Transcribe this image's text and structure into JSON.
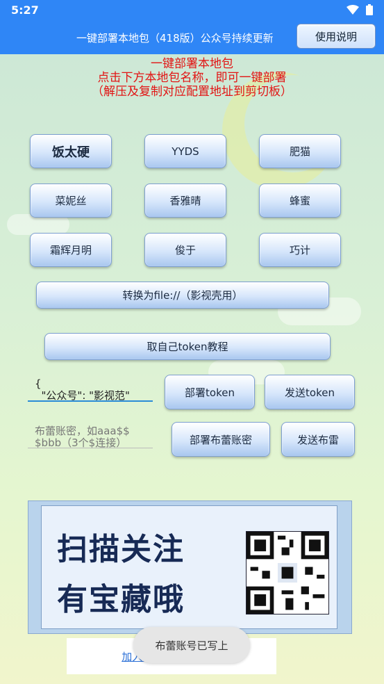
{
  "status_bar": {
    "time": "5:27"
  },
  "app_bar": {
    "title": "一键部署本地包（418版）公众号持续更新",
    "help_button": "使用说明"
  },
  "intro": {
    "line1": "一键部署本地包",
    "line2": "点击下方本地包名称，即可一键部署",
    "line3": "（解压及复制对应配置地址到剪切板）"
  },
  "packages": [
    {
      "label": "饭太硬"
    },
    {
      "label": "YYDS"
    },
    {
      "label": "肥猫"
    },
    {
      "label": "菜妮丝"
    },
    {
      "label": "香雅晴"
    },
    {
      "label": "蜂蜜"
    },
    {
      "label": "霜辉月明"
    },
    {
      "label": "俊于"
    },
    {
      "label": "巧计"
    }
  ],
  "convert_button": "转换为file://（影视壳用）",
  "token_tutorial_button": "取自己token教程",
  "token_input": {
    "value": "{\n  \"公众号\": \"影视范\""
  },
  "deploy_token_button": "部署token",
  "send_token_button": "发送token",
  "bulei_input": {
    "placeholder": "布蕾账密，如aaa$$\n$bbb（3个$连接）"
  },
  "deploy_bulei_button": "部署布蕾账密",
  "send_bulei_button": "发送布雷",
  "banner": {
    "line1": "扫描关注",
    "line2": "有宝藏哦"
  },
  "join_link": "加入影视范的QQ频道",
  "toast": "布蕾账号已写上",
  "colors": {
    "primary": "#2f86f6",
    "intro_red": "#e21414"
  }
}
